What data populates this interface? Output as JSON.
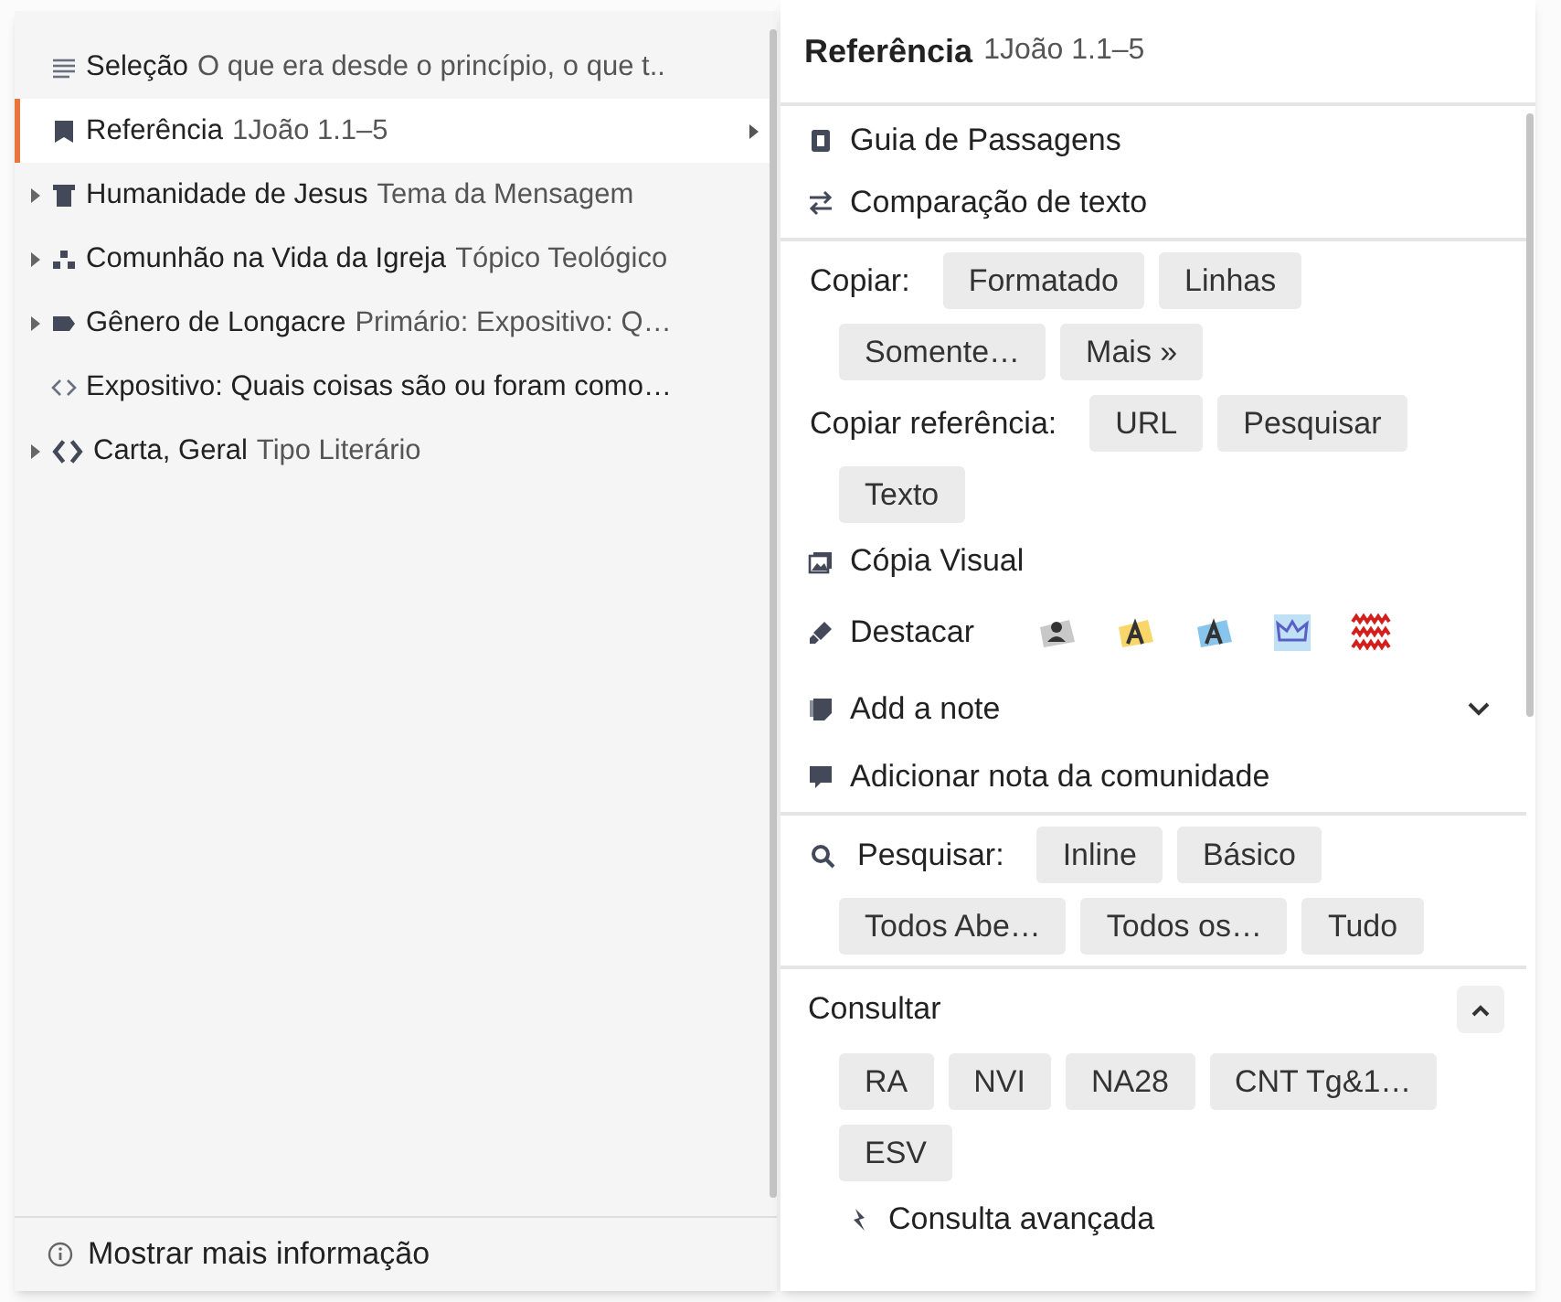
{
  "menu": {
    "items": [
      {
        "kind": "selection",
        "label": "Seleção",
        "detail": "O que era desde o princípio, o que t..",
        "expandable": false,
        "selected": false,
        "submenu": false
      },
      {
        "kind": "reference",
        "label": "Referência",
        "detail": "1João 1.1–5",
        "expandable": false,
        "selected": true,
        "submenu": true
      },
      {
        "kind": "theme",
        "label": "Humanidade de Jesus",
        "detail": "Tema da Mensagem",
        "expandable": true,
        "selected": false,
        "submenu": false
      },
      {
        "kind": "topic",
        "label": "Comunhão na Vida da Igreja",
        "detail": "Tópico Teológico",
        "expandable": true,
        "selected": false,
        "submenu": false
      },
      {
        "kind": "genre",
        "label": "Gênero de Longacre",
        "detail": "Primário: Expositivo: Q…",
        "expandable": true,
        "selected": false,
        "submenu": false
      },
      {
        "kind": "subgenre",
        "label": "Expositivo: Quais coisas são ou foram como…",
        "expandable": false,
        "selected": false,
        "submenu": false
      },
      {
        "kind": "literary",
        "label": "Carta, Geral",
        "detail": "Tipo Literário",
        "expandable": true,
        "selected": false,
        "submenu": false
      }
    ],
    "footer": "Mostrar mais informação"
  },
  "panel": {
    "title": "Referência",
    "subtitle": "1João 1.1–5",
    "sections": [
      {
        "rows": [
          {
            "kind": "guide",
            "label": "Guia de Passagens"
          },
          {
            "kind": "compare",
            "label": "Comparação de texto"
          }
        ]
      },
      {
        "rows": [
          {
            "kind": "buttons",
            "label": "Copiar:",
            "buttons": [
              "Formatado",
              "Linhas",
              "Somente…",
              "Mais »"
            ]
          },
          {
            "kind": "buttons",
            "label": "Copiar referência:",
            "buttons": [
              "URL",
              "Pesquisar",
              "Texto"
            ]
          },
          {
            "kind": "visual",
            "label": "Cópia Visual"
          },
          {
            "kind": "highlight",
            "label": "Destacar"
          },
          {
            "kind": "note",
            "label": "Add a note",
            "expanded": false
          },
          {
            "kind": "community",
            "label": "Adicionar nota da comunidade"
          }
        ]
      },
      {
        "rows": [
          {
            "kind": "search",
            "label": "Pesquisar:",
            "buttons": [
              "Inline",
              "Básico",
              "Todos Abe…",
              "Todos os…",
              "Tudo"
            ]
          }
        ]
      },
      {
        "header": "Consultar",
        "expanded": true,
        "rows": [
          {
            "kind": "buttons",
            "buttons": [
              "RA",
              "NVI",
              "NA28",
              "CNT Tg&1…",
              "ESV"
            ]
          },
          {
            "kind": "advanced",
            "label": "Consulta avançada"
          }
        ]
      }
    ]
  }
}
